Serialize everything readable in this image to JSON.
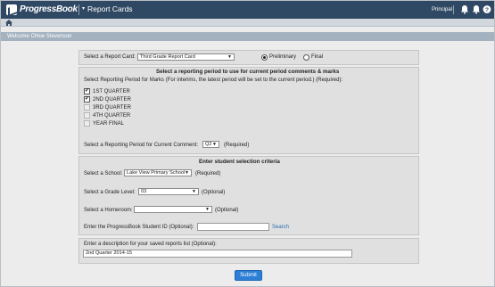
{
  "header": {
    "logo_text": "ProgressBook",
    "module_caret": "▾",
    "module_title": "Report Cards",
    "role": "Principal",
    "role_sep": "|"
  },
  "welcome": "Welcome Chloe Stevenson",
  "report_card": {
    "label": "Select a Report Card:",
    "value": "Third Grade Report Card",
    "caret": "▼",
    "options": [
      {
        "label": "Preliminary",
        "selected": true
      },
      {
        "label": "Final",
        "selected": false
      }
    ]
  },
  "reporting": {
    "title": "Select a reporting period to use for current period comments & marks",
    "marks_label": "Select Reporting Period for Marks (For interims, the latest period will be set to the current period.) (Required):",
    "periods": [
      {
        "label": "1ST QUARTER",
        "checked": true,
        "enabled": true
      },
      {
        "label": "2ND QUARTER",
        "checked": true,
        "enabled": true
      },
      {
        "label": "3RD QUARTER",
        "checked": false,
        "enabled": false
      },
      {
        "label": "4TH QUARTER",
        "checked": false,
        "enabled": false
      },
      {
        "label": "YEAR FINAL",
        "checked": false,
        "enabled": false
      }
    ],
    "check_mark": "✔",
    "comment_label": "Select a Reporting Period for Current Comment:",
    "comment_value": "Q2",
    "comment_required": "(Required)"
  },
  "criteria": {
    "title": "Enter student selection criteria",
    "school_label": "Select a School:",
    "school_value": "Lake View Primary School",
    "school_required": "(Required)",
    "grade_label": "Select a Grade Level:",
    "grade_value": "03",
    "grade_optional": "(Optional)",
    "homeroom_label": "Select a Homeroom:",
    "homeroom_value": "",
    "homeroom_optional": "(Optional)",
    "student_id_label": "Enter the ProgressBook Student ID (Optional):",
    "student_id_value": "",
    "search_link": "Search"
  },
  "description": {
    "label": "Enter a description for your saved reports list (Optional):",
    "value": "2nd Quarter 2014-15"
  },
  "submit_label": "Submit"
}
